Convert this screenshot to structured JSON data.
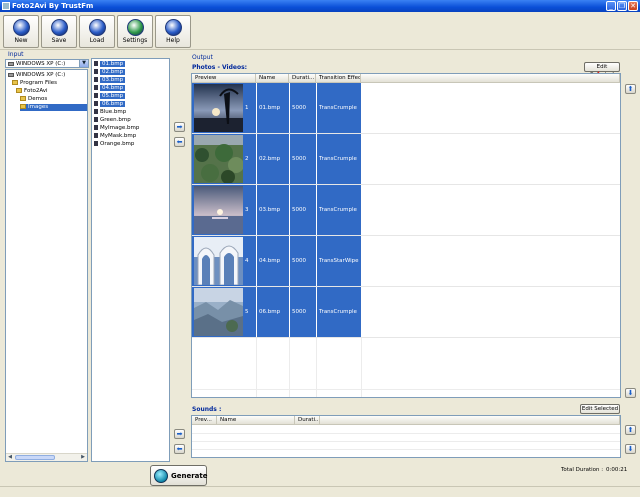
{
  "window": {
    "title": "Foto2Avi By TrustFm",
    "minimize": "_",
    "restore": "❐",
    "close": "✕"
  },
  "toolbar": [
    {
      "label": "New",
      "icon": "new-icon",
      "color": "#2a5cc8"
    },
    {
      "label": "Save",
      "icon": "save-icon",
      "color": "#2a5cc8"
    },
    {
      "label": "Load",
      "icon": "load-icon",
      "color": "#2a5cc8"
    },
    {
      "label": "Settings",
      "icon": "settings-icon",
      "color": "#2f9a4a"
    },
    {
      "label": "Help",
      "icon": "help-icon",
      "color": "#2a5cc8"
    }
  ],
  "input": {
    "label": "Input",
    "drive_select": "WINDOWS XP (C:)",
    "tree": [
      {
        "label": "WINDOWS XP (C:)",
        "type": "drive",
        "level": 0
      },
      {
        "label": "Program Files",
        "type": "folder",
        "level": 1
      },
      {
        "label": "Foto2Avi",
        "type": "folder",
        "level": 2
      },
      {
        "label": "Demos",
        "type": "folder",
        "level": 3
      },
      {
        "label": "Images",
        "type": "folder",
        "level": 3,
        "selected": true
      }
    ],
    "files": [
      {
        "name": "01.bmp",
        "selected": true
      },
      {
        "name": "02.bmp",
        "selected": true
      },
      {
        "name": "03.bmp",
        "selected": true
      },
      {
        "name": "04.bmp",
        "selected": true
      },
      {
        "name": "05.bmp",
        "selected": true
      },
      {
        "name": "06.bmp",
        "selected": true
      },
      {
        "name": "Blue.bmp",
        "selected": false
      },
      {
        "name": "Green.bmp",
        "selected": false
      },
      {
        "name": "MyImage.bmp",
        "selected": false
      },
      {
        "name": "MyMask.bmp",
        "selected": false
      },
      {
        "name": "Orange.bmp",
        "selected": false
      }
    ]
  },
  "output": {
    "label": "Output",
    "photos_label": "Photos - Videos:",
    "edit_selected": "Edit Selected",
    "columns": [
      "Preview",
      "Name",
      "Durati...",
      "Transition Effect"
    ],
    "rows": [
      {
        "index": "1",
        "name": "01.bmp",
        "duration": "5000",
        "effect": "TransCrumple",
        "thumb": "sunset"
      },
      {
        "index": "2",
        "name": "02.bmp",
        "duration": "5000",
        "effect": "TransCrumple",
        "thumb": "foliage"
      },
      {
        "index": "3",
        "name": "03.bmp",
        "duration": "5000",
        "effect": "TransCrumple",
        "thumb": "sea"
      },
      {
        "index": "4",
        "name": "04.bmp",
        "duration": "5000",
        "effect": "TransStarWipe",
        "thumb": "arches"
      },
      {
        "index": "5",
        "name": "06.bmp",
        "duration": "5000",
        "effect": "TransCrumple",
        "thumb": "rocks"
      }
    ],
    "sounds_label": "Sounds :",
    "sounds_edit_selected": "Edit Selected",
    "sound_columns": [
      "Prev...",
      "Name",
      "Durati..."
    ]
  },
  "footer": {
    "generate": "Generate",
    "total_duration_label": "Total Duration :",
    "total_duration_value": "0:00:21"
  },
  "colors": {
    "selection": "#316ac5",
    "accent": "#00289c"
  }
}
